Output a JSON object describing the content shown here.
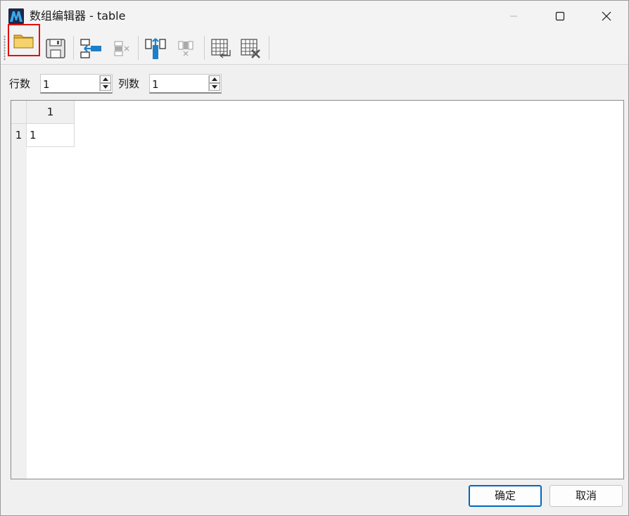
{
  "window": {
    "title": "数组编辑器 - table"
  },
  "toolbar": {
    "buttons": [
      {
        "icon": "open-folder-icon"
      },
      {
        "icon": "save-icon"
      },
      {
        "icon": "insert-row-icon"
      },
      {
        "icon": "delete-row-icon"
      },
      {
        "icon": "insert-column-icon"
      },
      {
        "icon": "delete-column-icon"
      },
      {
        "icon": "table-import-icon"
      },
      {
        "icon": "table-clear-icon"
      }
    ]
  },
  "dims": {
    "rows_label": "行数",
    "rows_value": "1",
    "cols_label": "列数",
    "cols_value": "1"
  },
  "grid": {
    "column_headers": [
      "1"
    ],
    "row_headers": [
      "1"
    ],
    "cells": [
      [
        "1"
      ]
    ]
  },
  "buttons": {
    "ok": "确定",
    "cancel": "取消"
  },
  "colors": {
    "accent": "#0067c0",
    "selection_outline": "#e01010",
    "folder": "#f2c84b",
    "tool_blue": "#1e7fc8"
  }
}
